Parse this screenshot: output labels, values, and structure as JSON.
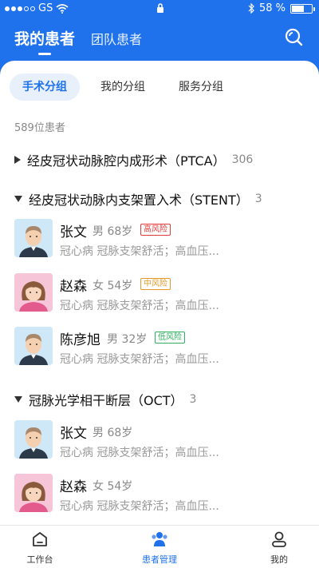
{
  "statusbar": {
    "carrier": "GS",
    "battery_text": "58 %"
  },
  "header": {
    "tab_active": "我的患者",
    "tab_other": "团队患者",
    "search_icon": "search-icon"
  },
  "segments": [
    {
      "label": "手术分组",
      "active": true
    },
    {
      "label": "我的分组",
      "active": false
    },
    {
      "label": "服务分组",
      "active": false
    }
  ],
  "patient_count": "589位患者",
  "groups": [
    {
      "title": "经皮冠状动脉腔内成形术（PTCA）",
      "count": "306",
      "expanded": false
    },
    {
      "title": "经皮冠状动脉内支架置入术（STENT）",
      "count": "3",
      "expanded": true
    },
    {
      "title": "冠脉光学相干断层（OCT）",
      "count": "3",
      "expanded": true
    }
  ],
  "patients_stent": [
    {
      "name": "张文",
      "meta": "男 68岁",
      "risk": "高风险",
      "risk_level": "high",
      "diag": "冠心病 冠脉支架舒活；高血压..."
    },
    {
      "name": "赵森",
      "meta": "女 54岁",
      "risk": "中风险",
      "risk_level": "mid",
      "diag": "冠心病 冠脉支架舒活；高血压..."
    },
    {
      "name": "陈彦旭",
      "meta": "男 32岁",
      "risk": "低风险",
      "risk_level": "low",
      "diag": "冠心病 冠脉支架舒活；高血压..."
    }
  ],
  "patients_oct": [
    {
      "name": "张文",
      "meta": "男 68岁",
      "diag": "冠心病 冠脉支架舒活；高血压..."
    },
    {
      "name": "赵森",
      "meta": "女 54岁",
      "diag": "冠心病 冠脉支架舒活；高血压..."
    }
  ],
  "bottom_nav": [
    {
      "label": "工作台",
      "icon": "home-icon",
      "active": false
    },
    {
      "label": "患者管理",
      "icon": "patients-icon",
      "active": true
    },
    {
      "label": "我的",
      "icon": "user-icon",
      "active": false
    }
  ],
  "colors": {
    "primary": "#1f72ec",
    "high": "#e23b3b",
    "mid": "#e39a2a",
    "low": "#2eaf5d"
  }
}
